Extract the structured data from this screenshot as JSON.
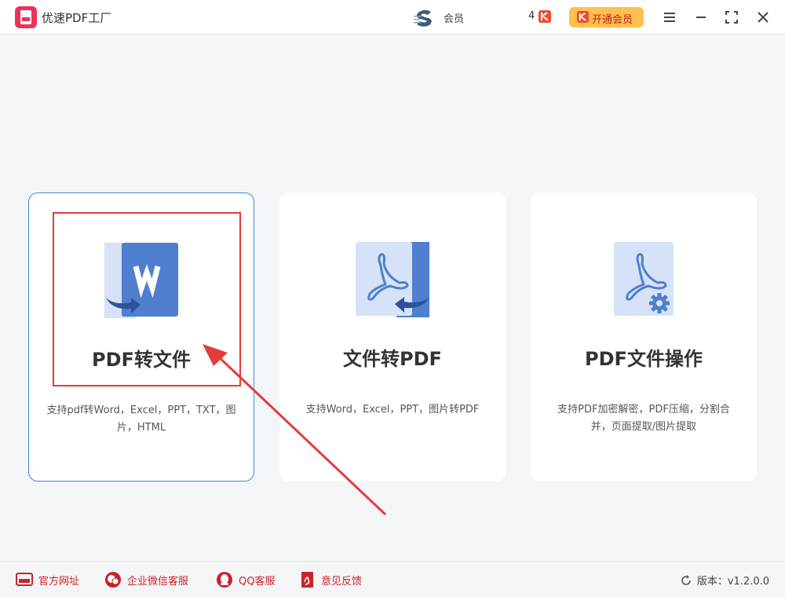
{
  "app": {
    "title": "优速PDF工厂"
  },
  "header": {
    "user_label": "会员",
    "coin_count": "4",
    "vip_button_label": "开通会员"
  },
  "cards": [
    {
      "title": "PDF转文件",
      "description": "支持pdf转Word，Excel，PPT，TXT，图片，HTML",
      "icon": "pdf-to-word-icon"
    },
    {
      "title": "文件转PDF",
      "description": "支持Word，Excel，PPT，图片转PDF",
      "icon": "file-to-pdf-icon"
    },
    {
      "title": "PDF文件操作",
      "description": "支持PDF加密解密，PDF压缩，分割合并，页面提取/图片提取",
      "icon": "pdf-tools-icon"
    }
  ],
  "footer": {
    "links": [
      {
        "label": "官方网址",
        "icon": "website-icon"
      },
      {
        "label": "企业微信客服",
        "icon": "wechat-icon"
      },
      {
        "label": "QQ客服",
        "icon": "qq-icon"
      },
      {
        "label": "意见反馈",
        "icon": "feedback-icon"
      }
    ],
    "version": "版本：v1.2.0.0"
  },
  "colors": {
    "accent": "#3b8be0",
    "brand_red": "#c7232a",
    "vip_bg": "#ffc04d",
    "icon_blue": "#4f7fce",
    "icon_light": "#d5e2f7"
  }
}
